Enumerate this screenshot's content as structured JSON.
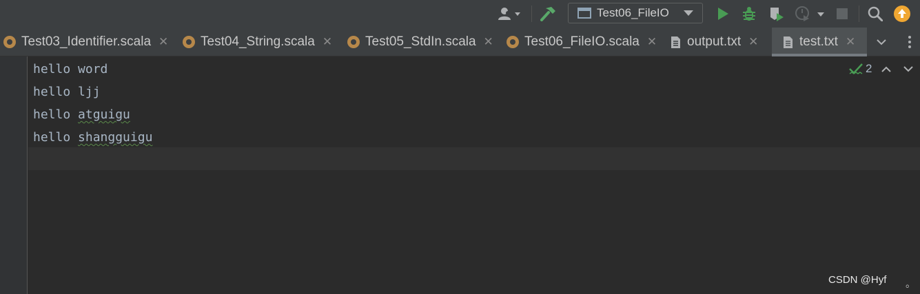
{
  "toolbar": {
    "run_config": "Test06_FileIO",
    "icons": [
      "user-icon",
      "build-hammer-icon",
      "run-icon",
      "debug-icon",
      "coverage-icon",
      "profile-icon",
      "stop-icon",
      "search-icon",
      "update-icon"
    ]
  },
  "tabs": [
    {
      "label": "Test03_Identifier.scala",
      "type": "scala",
      "active": false
    },
    {
      "label": "Test04_String.scala",
      "type": "scala",
      "active": false
    },
    {
      "label": "Test05_StdIn.scala",
      "type": "scala",
      "active": false
    },
    {
      "label": "Test06_FileIO.scala",
      "type": "scala",
      "active": false
    },
    {
      "label": "output.txt",
      "type": "text",
      "active": false
    },
    {
      "label": "test.txt",
      "type": "text",
      "active": true
    }
  ],
  "editor": {
    "lines": [
      {
        "word": "hello",
        "rest": "word"
      },
      {
        "word": "hello",
        "rest": "ljj"
      },
      {
        "word": "hello",
        "rest": "atguigu"
      },
      {
        "word": "hello",
        "rest": "shangguigu"
      }
    ],
    "inspection_count": "2"
  },
  "watermark": "CSDN @Hyf",
  "colors": {
    "accent_green": "#499c54",
    "scala_orange": "#b7884a",
    "update_orange": "#f0a732"
  }
}
